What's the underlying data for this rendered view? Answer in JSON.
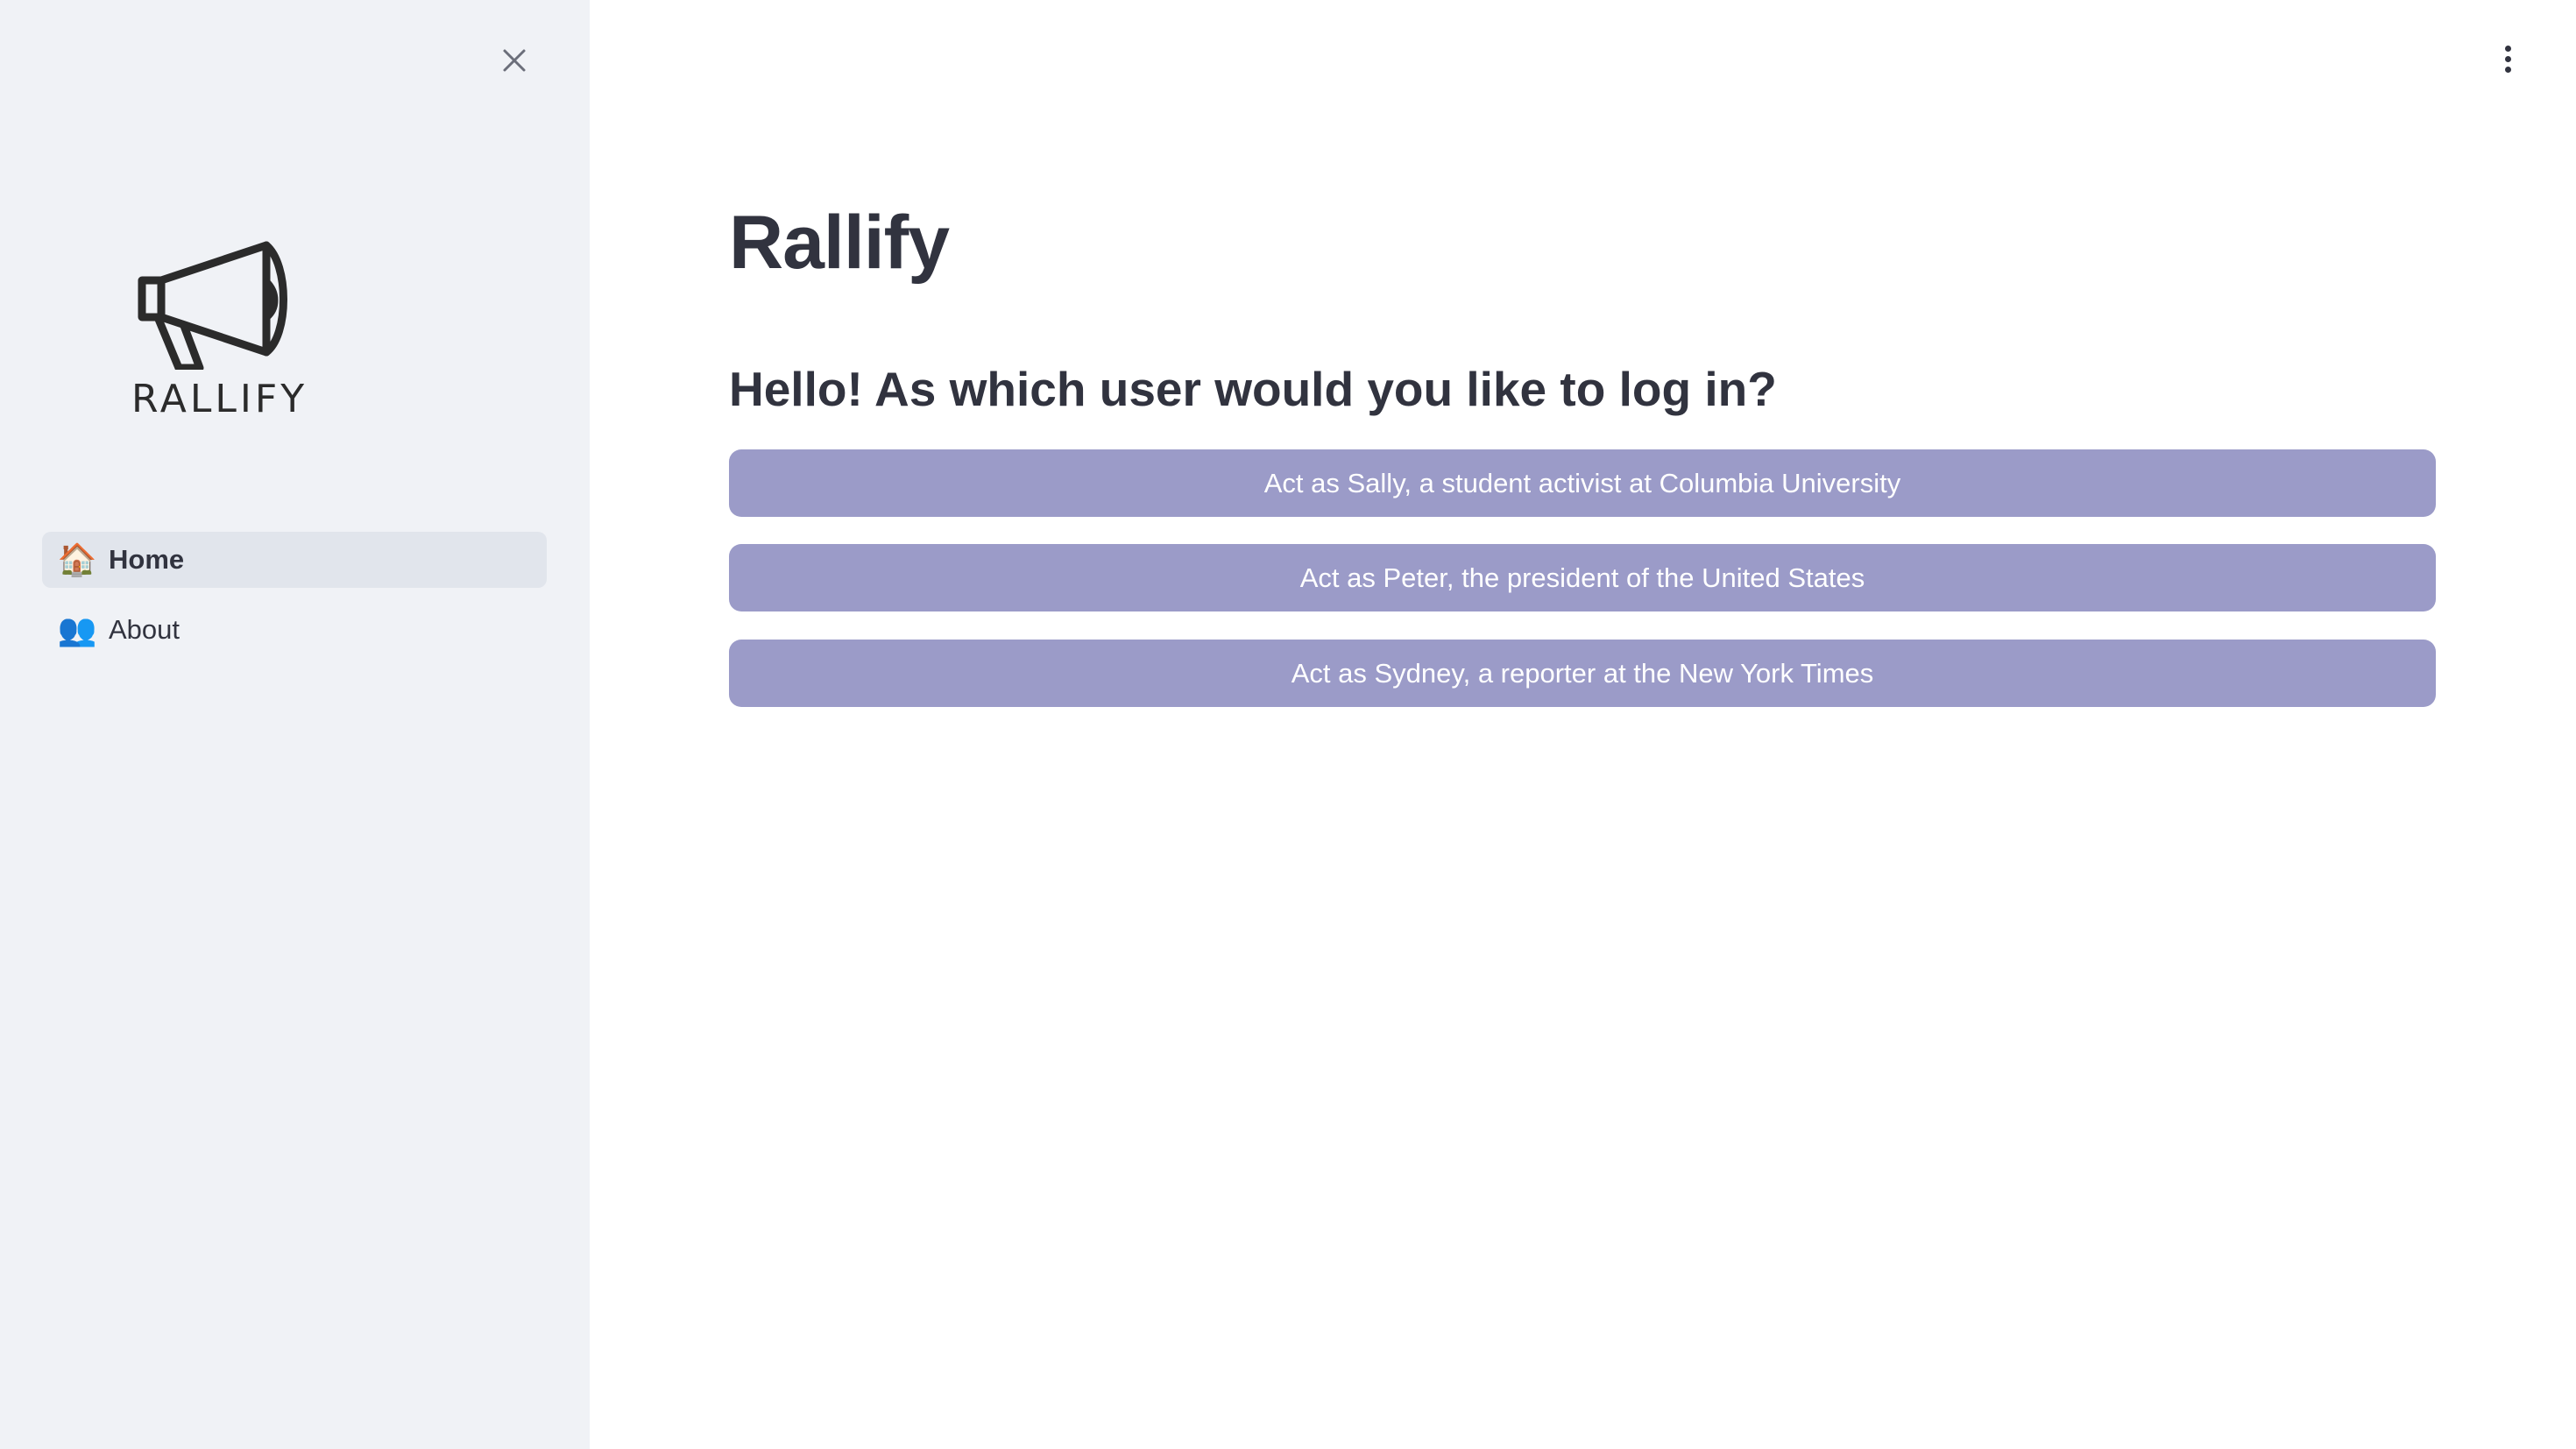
{
  "sidebar": {
    "logo_text": "RALLIFY",
    "nav": [
      {
        "icon": "🏠",
        "label": "Home",
        "active": true
      },
      {
        "icon": "👥",
        "label": "About",
        "active": false
      }
    ]
  },
  "main": {
    "title": "Rallify",
    "subtitle": "Hello! As which user would you like to log in?",
    "buttons": [
      {
        "label": "Act as Sally, a student activist at Columbia University"
      },
      {
        "label": "Act as Peter, the president of the United States"
      },
      {
        "label": "Act as Sydney, a reporter at the New York Times"
      }
    ]
  },
  "colors": {
    "sidebar_bg": "#f0f2f6",
    "active_nav_bg": "#e1e5ec",
    "button_bg": "#9b9bc8",
    "text": "#31333f"
  }
}
